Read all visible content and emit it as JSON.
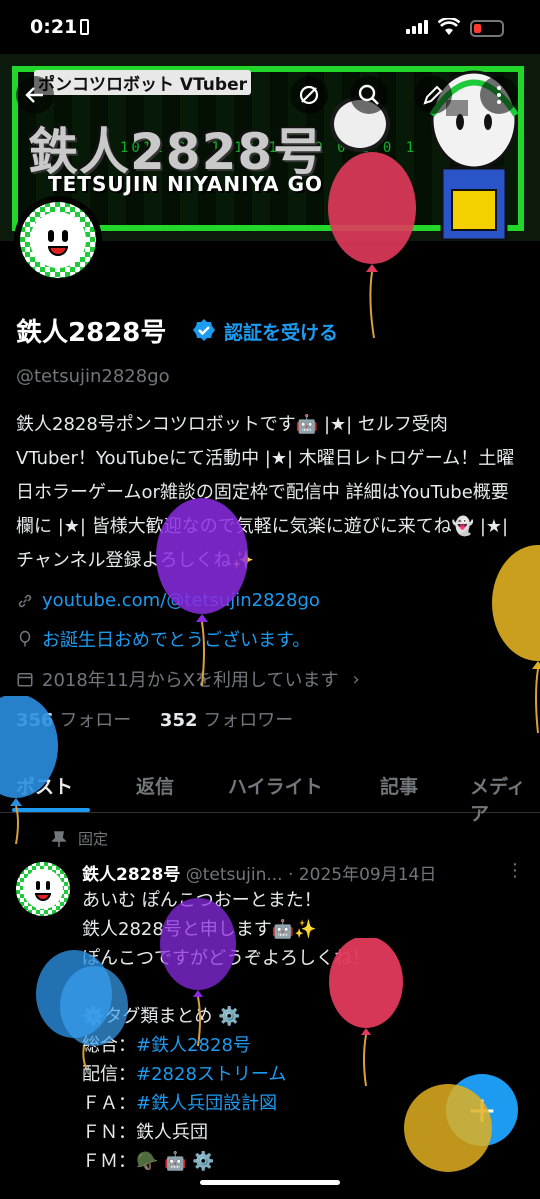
{
  "status": {
    "time": "0:21"
  },
  "banner": {
    "subtitle": "ポンコツロボット VTuber",
    "title": "鉄人2828号",
    "name_en": "TETSUJIN NIYANIYA GO",
    "code": "1011 00 1 10 11 10 0 1 0 1"
  },
  "profile": {
    "name": "鉄人2828号",
    "verify_label": "認証を受ける",
    "handle": "@tetsujin2828go",
    "bio": "鉄人2828号ポンコツロボットです🤖 |★| セルフ受肉VTuber！YouTubeにて活動中 |★| 木曜日レトロゲーム！土曜日ホラーゲームor雑談の固定枠で配信中 詳細はYouTube概要欄に |★| 皆様大歓迎なので気軽に気楽に遊びに来てね👻 |★| チャンネル登録よろしくね✨",
    "link": "youtube.com/@tetsujin2828go",
    "birthday": "お誕生日おめでとうございます。",
    "joined": "2018年11月からXを利用しています",
    "following_count": "356",
    "following_label": "フォロー",
    "followers_count": "352",
    "followers_label": "フォロワー"
  },
  "tabs": [
    "ポスト",
    "返信",
    "ハイライト",
    "記事",
    "メディア"
  ],
  "post": {
    "pinned_label": "固定",
    "author": "鉄人2828号",
    "handle": "@tetsujin...",
    "date": "· 2025年09月14日",
    "line1": "あいむ ぽんこつおーとまた！",
    "line2": "鉄人2828号と申します🤖✨",
    "line3": "ぽんこつですがどうぞよろしくね！",
    "line4": "",
    "line5": "⚙️タグ類まとめ ⚙️",
    "tag1_label": "総合：",
    "tag1": "#鉄人2828号",
    "tag2_label": "配信：",
    "tag2": "#2828ストリーム",
    "tag3_label": "ＦＡ：",
    "tag3": "#鉄人兵団設計図",
    "tag4_label": "ＦＮ：",
    "tag4": "鉄人兵団",
    "tag5_label": "ＦＭ：",
    "tag5": "🪖 🤖 ⚙️"
  },
  "fab": {
    "label": "+"
  },
  "colors": {
    "accent": "#1d9bf0",
    "background": "#000000",
    "banner_green": "#22d62a",
    "balloon_red": "#e23a5c",
    "balloon_purple": "#8a2be2",
    "balloon_yellow": "#e0b020",
    "balloon_blue": "#2a8fe0"
  }
}
